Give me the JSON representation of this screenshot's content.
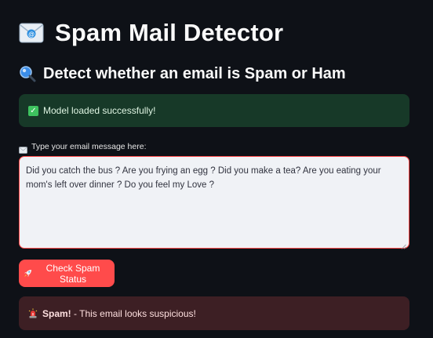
{
  "header": {
    "title_icon": "email-envelope-icon",
    "title": "Spam Mail Detector",
    "subtitle_icon": "magnifying-glass-icon",
    "subtitle": "Detect whether an email is Spam or Ham"
  },
  "success_alert": {
    "icon": "check-mark-icon",
    "text": "Model loaded successfully!",
    "color": "#173928"
  },
  "message_field": {
    "label_icon": "envelope-icon",
    "label": "Type your email message here:",
    "value": "Did you catch the bus ? Are you frying an egg ? Did you make a tea? Are you eating your mom's left over dinner ? Do you feel my Love ?"
  },
  "check_button": {
    "icon": "rocket-icon",
    "label": "Check Spam Status",
    "color": "#ff4b4b"
  },
  "result_alert": {
    "icon": "siren-icon",
    "strong": "Spam!",
    "text": " - This email looks suspicious!",
    "color": "#3d1f24"
  },
  "colors": {
    "background": "#0e1117",
    "accent": "#ff4b4b",
    "text": "#fafafa"
  }
}
